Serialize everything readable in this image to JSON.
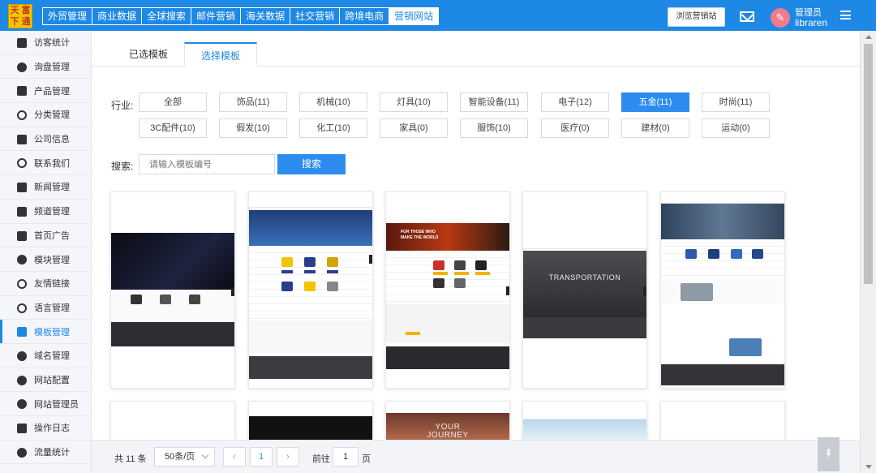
{
  "logo": {
    "chars": [
      "天",
      "富",
      "下",
      "通"
    ]
  },
  "topnav": {
    "items": [
      "外贸管理",
      "商业数据",
      "全球搜索",
      "邮件营销",
      "海关数据",
      "社交营销",
      "跨境电商",
      "营销网站"
    ],
    "active_index": 7
  },
  "header": {
    "browse_label": "浏览营销站",
    "user_name": "管理员",
    "user_account": "libraren",
    "avatar_glyph": "✎"
  },
  "sidebar": {
    "items": [
      {
        "label": "访客统计",
        "icon": "monitor-icon"
      },
      {
        "label": "询盘管理",
        "icon": "chat-icon"
      },
      {
        "label": "产品管理",
        "icon": "apps-icon"
      },
      {
        "label": "分类管理",
        "icon": "list-icon"
      },
      {
        "label": "公司信息",
        "icon": "building-icon"
      },
      {
        "label": "联系我们",
        "icon": "at-icon"
      },
      {
        "label": "新闻管理",
        "icon": "news-icon"
      },
      {
        "label": "频道管理",
        "icon": "grid-icon"
      },
      {
        "label": "首页广告",
        "icon": "cube-icon"
      },
      {
        "label": "模块管理",
        "icon": "puzzle-icon"
      },
      {
        "label": "友情链接",
        "icon": "compass-icon"
      },
      {
        "label": "语言管理",
        "icon": "globe-icon"
      },
      {
        "label": "模板管理",
        "icon": "shirt-icon"
      },
      {
        "label": "域名管理",
        "icon": "gear-icon"
      },
      {
        "label": "网站配置",
        "icon": "user-icon"
      },
      {
        "label": "网站管理员",
        "icon": "users-icon"
      },
      {
        "label": "操作日志",
        "icon": "doc-icon"
      },
      {
        "label": "流量统计",
        "icon": "pie-icon"
      }
    ],
    "active_index": 12
  },
  "tabs": [
    {
      "label": "已选模板",
      "active": false
    },
    {
      "label": "选择模板",
      "active": true
    }
  ],
  "filter": {
    "label": "行业:",
    "row1": [
      "全部",
      "饰品(11)",
      "机械(10)",
      "灯具(10)",
      "智能设备(11)",
      "电子(12)",
      "五金(11)",
      "时尚(11)"
    ],
    "row2": [
      "3C配件(10)",
      "假发(10)",
      "化工(10)",
      "家具(0)",
      "服饰(10)",
      "医疗(0)",
      "建材(0)",
      "运动(0)"
    ],
    "active": "五金(11)"
  },
  "search": {
    "label": "搜索:",
    "placeholder": "请输入模板编号",
    "button": "搜索"
  },
  "templates": {
    "hero_texts": {
      "t3_line1": "FOR THOSE WHO",
      "t3_line2": "MAKE THE WORLD",
      "t4": "TRANSPORTATION",
      "t8_line1": "YOUR",
      "t8_line2": "JOURNEY"
    }
  },
  "pager": {
    "total": "共 11 条",
    "page_size": "50条/页",
    "prev": "‹",
    "next": "›",
    "current": "1",
    "goto_label": "前往",
    "goto_value": "1",
    "page_suffix": "页"
  },
  "backtop_glyph": "⇞"
}
